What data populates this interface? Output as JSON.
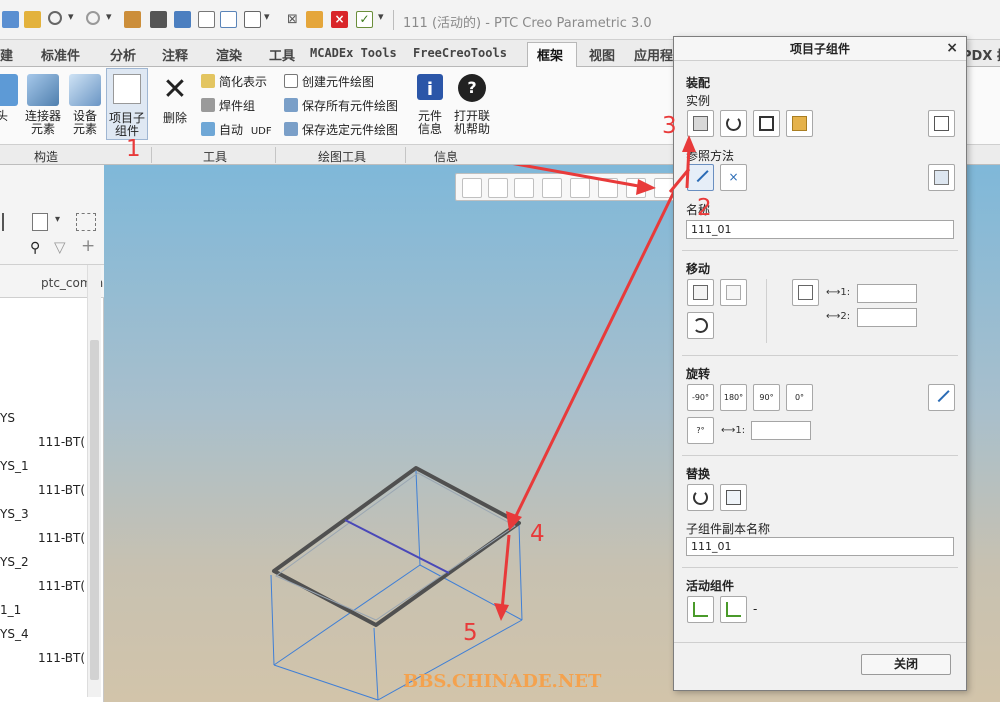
{
  "app": {
    "title": "111 (活动的) - PTC Creo Parametric 3.0"
  },
  "ribbon": {
    "tabs": [
      {
        "label": "建"
      },
      {
        "label": "标准件"
      },
      {
        "label": "分析"
      },
      {
        "label": "注释"
      },
      {
        "label": "渲染"
      },
      {
        "label": "工具"
      },
      {
        "label": "MCADEx Tools"
      },
      {
        "label": "FreeCreoTools"
      },
      {
        "label": "框架"
      },
      {
        "label": "视图"
      },
      {
        "label": "应用程"
      },
      {
        "label": "PDX 插"
      }
    ],
    "active_tab": "框架",
    "buttons": {
      "head": "头",
      "connector": "连接器\n元素",
      "device": "设备\n元素",
      "subassembly": "项目子\n组件",
      "delete": "删除",
      "simplified": "简化表示",
      "weld": "焊件组",
      "auto": "自动",
      "udf": "UDF",
      "create_drawing": "创建元件绘图",
      "save_all_drawings": "保存所有元件绘图",
      "save_selected_drawings": "保存选定元件绘图",
      "component_info": "元件\n信息",
      "open_help": "打开联\n机帮助"
    },
    "groups": [
      {
        "label": "构造"
      },
      {
        "label": "工具"
      },
      {
        "label": "绘图工具"
      },
      {
        "label": "信息"
      }
    ]
  },
  "model_tree": {
    "column_header": "ptc_comm",
    "rows": [
      {
        "name": "YS",
        "value": "111-BT("
      },
      {
        "name": "YS_1",
        "value": "111-BT("
      },
      {
        "name": "YS_3",
        "value": "111-BT("
      },
      {
        "name": "YS_2",
        "value": "111-BT("
      },
      {
        "name": "1_1",
        "value": ""
      },
      {
        "name": "YS_4",
        "value": "111-BT("
      }
    ]
  },
  "dialog": {
    "title": "项目子组件",
    "close_icon": "×",
    "assembly": {
      "title": "装配",
      "instance_label": "实例"
    },
    "reference_method": {
      "label": "参照方法"
    },
    "name": {
      "label": "名称",
      "value": "111_01"
    },
    "move": {
      "title": "移动",
      "dim1_label": "1:",
      "dim2_label": "2:"
    },
    "rotate": {
      "title": "旋转",
      "buttons": [
        "-90°",
        "180°",
        "90°",
        "0°",
        "?°"
      ],
      "dim1_label": "1:"
    },
    "replace": {
      "title": "替换",
      "copy_name_label": "子组件副本名称",
      "copy_name_value": "111_01"
    },
    "active_component": {
      "title": "活动组件",
      "value": "-"
    },
    "close_button": "关闭"
  },
  "annotations": {
    "steps": [
      "1",
      "2",
      "3",
      "4",
      "5"
    ],
    "color": "#e83a3a"
  },
  "watermark": "BBS.CHINADE.NET"
}
